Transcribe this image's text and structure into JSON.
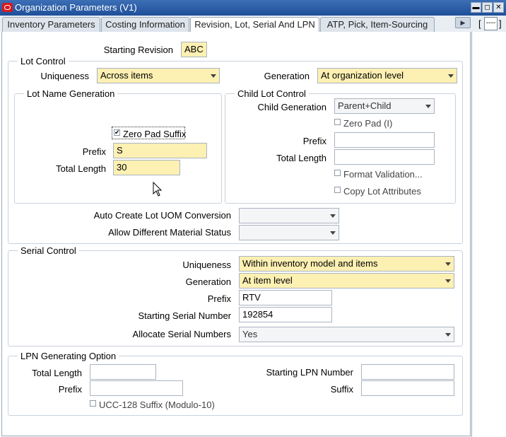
{
  "window": {
    "title": "Organization Parameters (V1)",
    "min": "▬",
    "max": "◻",
    "close": "✕"
  },
  "tabs": [
    {
      "label": "Inventory Parameters"
    },
    {
      "label": "Costing Information"
    },
    {
      "label": "Revision, Lot, Serial And LPN"
    },
    {
      "label": "ATP, Pick, Item-Sourcing"
    }
  ],
  "tab_scroll": "▶",
  "side": {
    "bracket_left": "[",
    "box": "----",
    "bracket_right": "]"
  },
  "revision": {
    "label": "Starting Revision",
    "value": "ABC"
  },
  "lot_control": {
    "legend": "Lot Control",
    "uniqueness_label": "Uniqueness",
    "uniqueness_value": "Across items",
    "generation_label": "Generation",
    "generation_value": "At organization level",
    "lot_name": {
      "legend": "Lot Name Generation",
      "zero_pad_label": "Zero Pad Suffix",
      "zero_pad_checked": true,
      "prefix_label": "Prefix",
      "prefix_value": "S",
      "total_length_label": "Total Length",
      "total_length_value": "30"
    },
    "child": {
      "legend": "Child Lot Control",
      "generation_label": "Child Generation",
      "generation_value": "Parent+Child",
      "zero_pad_label": "Zero Pad (I)",
      "prefix_label": "Prefix",
      "prefix_value": "",
      "total_length_label": "Total Length",
      "total_length_value": "",
      "format_validation_label": "Format Validation...",
      "copy_lot_label": "Copy Lot Attributes"
    },
    "auto_uom_label": "Auto Create Lot UOM Conversion",
    "allow_status_label": "Allow Different Material Status"
  },
  "serial_control": {
    "legend": "Serial Control",
    "uniqueness_label": "Uniqueness",
    "uniqueness_value": "Within inventory model and items",
    "generation_label": "Generation",
    "generation_value": "At item level",
    "prefix_label": "Prefix",
    "prefix_value": "RTV",
    "start_label": "Starting Serial Number",
    "start_value": "192854",
    "allocate_label": "Allocate Serial Numbers",
    "allocate_value": "Yes"
  },
  "lpn": {
    "legend": "LPN Generating Option",
    "total_length_label": "Total Length",
    "total_length_value": "",
    "prefix_label": "Prefix",
    "prefix_value": "",
    "start_label": "Starting LPN Number",
    "start_value": "",
    "suffix_label": "Suffix",
    "suffix_value": "",
    "ucc_label": "UCC-128 Suffix (Modulo-10)"
  },
  "colors": {
    "required_field": "#fdf0b3",
    "title_bar": "#1e4f99",
    "tab_bg": "#dde4ec"
  }
}
